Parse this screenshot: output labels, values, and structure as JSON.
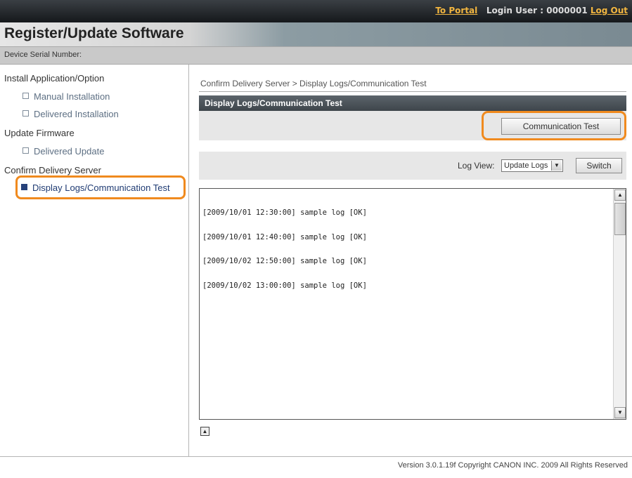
{
  "header": {
    "portal_link": "To Portal",
    "login_label": "Login User : 0000001",
    "logout_link": "Log Out",
    "title": "Register/Update Software",
    "serial_label": "Device Serial Number:"
  },
  "sidebar": {
    "sections": [
      {
        "label": "Install Application/Option"
      },
      {
        "label": "Update Firmware"
      },
      {
        "label": "Confirm Delivery Server"
      }
    ],
    "items": [
      {
        "label": "Manual Installation"
      },
      {
        "label": "Delivered Installation"
      },
      {
        "label": "Delivered Update"
      },
      {
        "label": "Display Logs/Communication Test"
      }
    ]
  },
  "main": {
    "breadcrumb": "Confirm Delivery Server > Display Logs/Communication Test",
    "panel_title": "Display Logs/Communication Test",
    "comm_test_button": "Communication Test",
    "log_view_label": "Log View:",
    "log_view_selected": "Update Logs",
    "switch_button": "Switch",
    "log_lines": [
      "[2009/10/01 12:30:00] sample log [OK]",
      "[2009/10/01 12:40:00] sample log [OK]",
      "[2009/10/02 12:50:00] sample log [OK]",
      "[2009/10/02 13:00:00] sample log [OK]"
    ]
  },
  "footer": {
    "text": "Version 3.0.1.19f Copyright CANON INC. 2009 All Rights Reserved"
  },
  "colors": {
    "highlight": "#f08a1e",
    "link": "#f2b640",
    "panel_header": "#4a5258"
  }
}
